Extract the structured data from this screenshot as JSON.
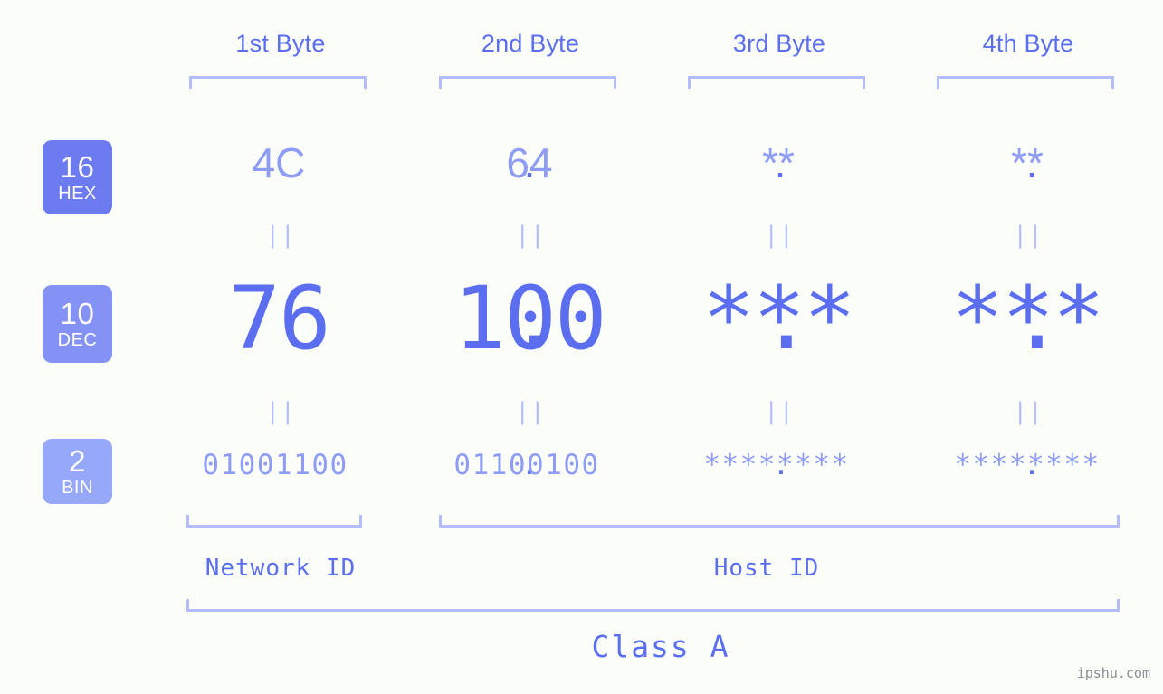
{
  "page": {
    "background": "#fbfdf8",
    "accent_strong": "#5b6ef0",
    "accent_light": "#8f9cf6",
    "accent_bracket": "#b3bdfb"
  },
  "header": {
    "byte_labels": [
      "1st Byte",
      "2nd Byte",
      "3rd Byte",
      "4th Byte"
    ]
  },
  "bases": [
    {
      "num": "16",
      "abbr": "HEX",
      "color": "#6c7bef"
    },
    {
      "num": "10",
      "abbr": "DEC",
      "color": "#8492f5"
    },
    {
      "num": "2",
      "abbr": "BIN",
      "color": "#96a8fa"
    }
  ],
  "rows": {
    "hex": {
      "label": "HEX",
      "values": [
        "4C",
        "64",
        "**",
        "**"
      ],
      "separator": "."
    },
    "dec": {
      "label": "DEC",
      "values": [
        "76",
        "100",
        "***",
        "***"
      ],
      "separator": "."
    },
    "bin": {
      "label": "BIN",
      "values": [
        "01001100",
        "01100100",
        "********",
        "********"
      ],
      "separator": "."
    }
  },
  "equals_marks": {
    "glyph": "||"
  },
  "footer": {
    "network_id_label": "Network ID",
    "host_id_label": "Host ID",
    "class_label": "Class A"
  },
  "watermark": {
    "text": "ipshu.com"
  }
}
